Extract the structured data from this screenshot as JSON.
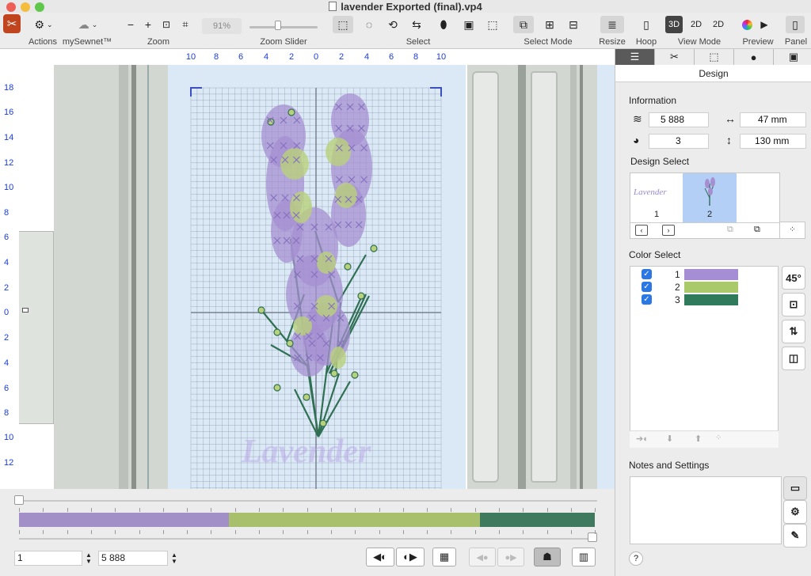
{
  "window": {
    "title": "lavender Exported (final).vp4"
  },
  "toolbar": {
    "actions_label": "Actions",
    "mysewnet_label": "mySewnet™",
    "zoom_label": "Zoom",
    "zoom_value": "91%",
    "zoom_slider_label": "Zoom Slider",
    "zoom_slider_value": 0.4,
    "select_label": "Select",
    "select_mode_label": "Select Mode",
    "resize_label": "Resize",
    "hoop_label": "Hoop",
    "view_mode_label": "View Mode",
    "view_3d": "3D",
    "view_2d": "2D",
    "view_2d_b": "2D",
    "preview_label": "Preview",
    "panel_label": "Panel"
  },
  "ruler": {
    "top": [
      "10",
      "8",
      "6",
      "4",
      "2",
      "0",
      "2",
      "4",
      "6",
      "8",
      "10"
    ],
    "left": [
      "18",
      "16",
      "14",
      "12",
      "10",
      "8",
      "6",
      "4",
      "2",
      "0",
      "2",
      "4",
      "6",
      "8",
      "10",
      "12"
    ]
  },
  "canvas": {
    "watermark": "Lavender",
    "colors": {
      "fabric": "#dbe9f7",
      "grid": "#5a6678",
      "purple": "#a58fd0",
      "lightgreen": "#b9d17a",
      "darkgreen": "#2f6f52"
    }
  },
  "timeline": {
    "segments": [
      {
        "color": "#a38fc7",
        "fraction": 0.365
      },
      {
        "color": "#a8bf6b",
        "fraction": 0.436
      },
      {
        "color": "#3f7a5e",
        "fraction": 0.199
      }
    ],
    "start_value": "1",
    "end_value": "5 888"
  },
  "panel": {
    "tab_active": "Design",
    "information_label": "Information",
    "stitches": "5 888",
    "width": "47 mm",
    "colors_count": "3",
    "height": "130 mm",
    "design_select_label": "Design Select",
    "designs": [
      {
        "number": "1",
        "thumb_text": "Lavender"
      },
      {
        "number": "2"
      }
    ],
    "color_select_label": "Color Select",
    "color_rows": [
      {
        "number": "1",
        "color": "#a68ed4"
      },
      {
        "number": "2",
        "color": "#a9c96a"
      },
      {
        "number": "3",
        "color": "#2f7a5a"
      }
    ],
    "rotate_label": "45°",
    "notes_label": "Notes and Settings",
    "help": "?"
  }
}
